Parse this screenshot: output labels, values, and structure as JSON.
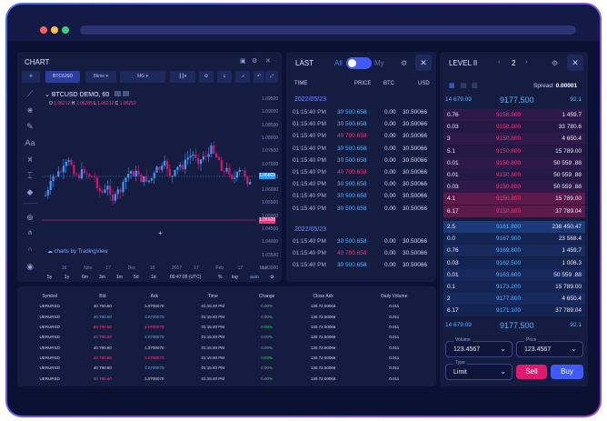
{
  "chart": {
    "title": "CHART",
    "pair": "BTC/USD",
    "interval": "8time",
    "ma": "MG",
    "symbol_line": "BTCUSD DEMO, 60",
    "ohlc": {
      "o": "1.06212",
      "h": "1.06285",
      "l": "1.06212",
      "c": "1.06252"
    },
    "y_ticks": [
      "1.09500",
      "1.09000",
      "1.08500",
      "1.08000",
      "1.07500",
      "1.07000",
      "1.06500",
      "1.06000",
      "1.05500",
      "1.05000",
      "1.04500",
      "1.04000",
      "1.03500",
      "1.03000"
    ],
    "price_tag_blue": "1.06629",
    "price_tag_pink": "1.06628",
    "x_ticks": [
      "16",
      "Nov",
      "17",
      "Dec",
      "16",
      "2017",
      "17",
      "Feb",
      "17",
      "Mar"
    ],
    "watermark": "charts by TradingView",
    "ranges": [
      "5y",
      "1y",
      "6m",
      "3m",
      "1m",
      "5d",
      "1d"
    ],
    "clock": "09:47:09 (UTC)",
    "opts": [
      "%",
      "log",
      "auto"
    ]
  },
  "last": {
    "title": "LAST",
    "toggle_all": "All",
    "toggle_my": "My",
    "headers": [
      "TIME",
      "PRICE",
      "BTC",
      "USD"
    ],
    "dates": [
      "2022/05/23",
      "2022/05/23"
    ],
    "group1": [
      {
        "t": "01:15:40 PM",
        "p": "30 500.658",
        "b": "0.00",
        "u": "30.50066",
        "c": "b"
      },
      {
        "t": "01:15:40 PM",
        "p": "30 500.658",
        "b": "0.00",
        "u": "30.50066",
        "c": "b"
      },
      {
        "t": "01:15:40 PM",
        "p": "40 700.658",
        "b": "0.00",
        "u": "30.50066",
        "c": "p"
      },
      {
        "t": "01:15:40 PM",
        "p": "30 500.658",
        "b": "0.00",
        "u": "30.50066",
        "c": "b"
      },
      {
        "t": "01:15:40 PM",
        "p": "30 500.658",
        "b": "0.00",
        "u": "30.50066",
        "c": "b"
      },
      {
        "t": "01:15:40 PM",
        "p": "40 700.658",
        "b": "0.00",
        "u": "30.50066",
        "c": "p"
      },
      {
        "t": "01:15:40 PM",
        "p": "30 500.658",
        "b": "0.00",
        "u": "30.50066",
        "c": "b"
      },
      {
        "t": "01:15:40 PM",
        "p": "30 500.658",
        "b": "0.00",
        "u": "30.50066",
        "c": "b"
      },
      {
        "t": "01:15:40 PM",
        "p": "30 500.658",
        "b": "0.00",
        "u": "30.50066",
        "c": "b"
      }
    ],
    "group2": [
      {
        "t": "01:15:40 PM",
        "p": "30 500.658",
        "b": "0.00",
        "u": "30.50066",
        "c": "b"
      },
      {
        "t": "01:15:40 PM",
        "p": "40 700.658",
        "b": "0.00",
        "u": "30.50066",
        "c": "p"
      },
      {
        "t": "01:15:40 PM",
        "p": "30 500.658",
        "b": "0.00",
        "u": "30.50066",
        "c": "b"
      }
    ]
  },
  "level2": {
    "title": "LEVEL II",
    "depth": "2",
    "spread_label": "Spread:",
    "spread_value": "0.00001",
    "top_bid": "14 679.09",
    "mid": "9177.500",
    "top_ask": "92.1",
    "asks": [
      {
        "a": "0.76",
        "p": "9158.800",
        "v": "1 459.7"
      },
      {
        "a": "0.03",
        "p": "9158.800",
        "v": "33 780.6"
      },
      {
        "a": "3",
        "p": "9150.800",
        "v": "4 650.4"
      },
      {
        "a": "5.1",
        "p": "9150.800",
        "v": "15 789.00"
      },
      {
        "a": "0.01",
        "p": "9150.800",
        "v": "50 559 .88"
      },
      {
        "a": "0.01",
        "p": "9150.800",
        "v": "50 559 .88"
      },
      {
        "a": "0.03",
        "p": "9150.800",
        "v": "50 559 .88"
      },
      {
        "a": "4.1",
        "p": "9150.800",
        "v": "15 789.00"
      },
      {
        "a": "6.17",
        "p": "9150.800",
        "v": "37 789.04"
      }
    ],
    "bids": [
      {
        "a": "2.5",
        "p": "9161.800",
        "v": "238 450.47"
      },
      {
        "a": "0.0",
        "p": "9167.900",
        "v": "23 568.4"
      },
      {
        "a": "0.76",
        "p": "9169.800",
        "v": "1 459.7"
      },
      {
        "a": "0.03",
        "p": "9162.500",
        "v": "1 006.3"
      },
      {
        "a": "0.01",
        "p": "9163.600",
        "v": "50 559 .88"
      },
      {
        "a": "0.1",
        "p": "9173.200",
        "v": "15 789.00"
      },
      {
        "a": "2",
        "p": "9177.800",
        "v": "4 650.4"
      },
      {
        "a": "6.17",
        "p": "9171.100",
        "v": "37 789.04"
      }
    ],
    "bottom_bid": "14 679.09",
    "bottom_mid": "9177.500",
    "bottom_ask": "92.1",
    "volume_label": "Volume",
    "volume_value": "123.4567",
    "price_label": "Price",
    "price_value": "123.4567",
    "type_label": "Type",
    "type_value": "Limit",
    "sell": "Sell",
    "buy": "Buy"
  },
  "table": {
    "headers": [
      "Symbol",
      "Bid",
      "Ask",
      "Time",
      "Change",
      "Close Ask",
      "Daily Volume"
    ],
    "rows": [
      [
        "UERURSD",
        "40 790.60",
        "1.0700070",
        "01:15:40 PM",
        "0.00%",
        "130.72.50066",
        "0.011"
      ],
      [
        "UERURSD",
        "40 790.60",
        "1.0700070",
        "01:15:40 PM",
        "0.00%",
        "130.72.50066",
        "0.011"
      ],
      [
        "UERURSD",
        "40 790.60",
        "1.0700070",
        "01:15:40 PM",
        "0.00%",
        "130.72.50066",
        "0.011"
      ],
      [
        "UERURSD",
        "40 790.60",
        "1.0700070",
        "01:15:40 PM",
        "0.00%",
        "130.72.50066",
        "0.011"
      ],
      [
        "UERURSD",
        "40 790.60",
        "1.0700070",
        "01:15:40 PM",
        "0.00%",
        "130.72.50066",
        "0.011"
      ],
      [
        "UERURSD",
        "40 790.60",
        "1.0700070",
        "01:15:40 PM",
        "0.00%",
        "130.72.50066",
        "0.011"
      ],
      [
        "UERURSD",
        "40 790.60",
        "1.0700070",
        "01:15:40 PM",
        "0.00%",
        "130.72.50066",
        "0.011"
      ],
      [
        "UERURSD",
        "40 790.60",
        "1.0700070",
        "01:15:40 PM",
        "0.00%",
        "130.72.50066",
        "0.011"
      ]
    ],
    "row_colors": [
      [
        "#d0d5f2",
        "#d0d5f2"
      ],
      [
        "#4fb3ff",
        "#4fb3ff"
      ],
      [
        "#ff3d8a",
        "#ff3d8a"
      ],
      [
        "#ff3d8a",
        "#4fb3ff"
      ],
      [
        "#d0d5f2",
        "#d0d5f2"
      ],
      [
        "#ff3d8a",
        "#ff3d8a"
      ],
      [
        "#d0d5f2",
        "#4fb3ff"
      ],
      [
        "#ff3d8a",
        "#d0d5f2"
      ]
    ]
  },
  "colors": {
    "blue": "#2f9cff",
    "pink": "#ff2d7a",
    "accent": "#3d5bff"
  }
}
